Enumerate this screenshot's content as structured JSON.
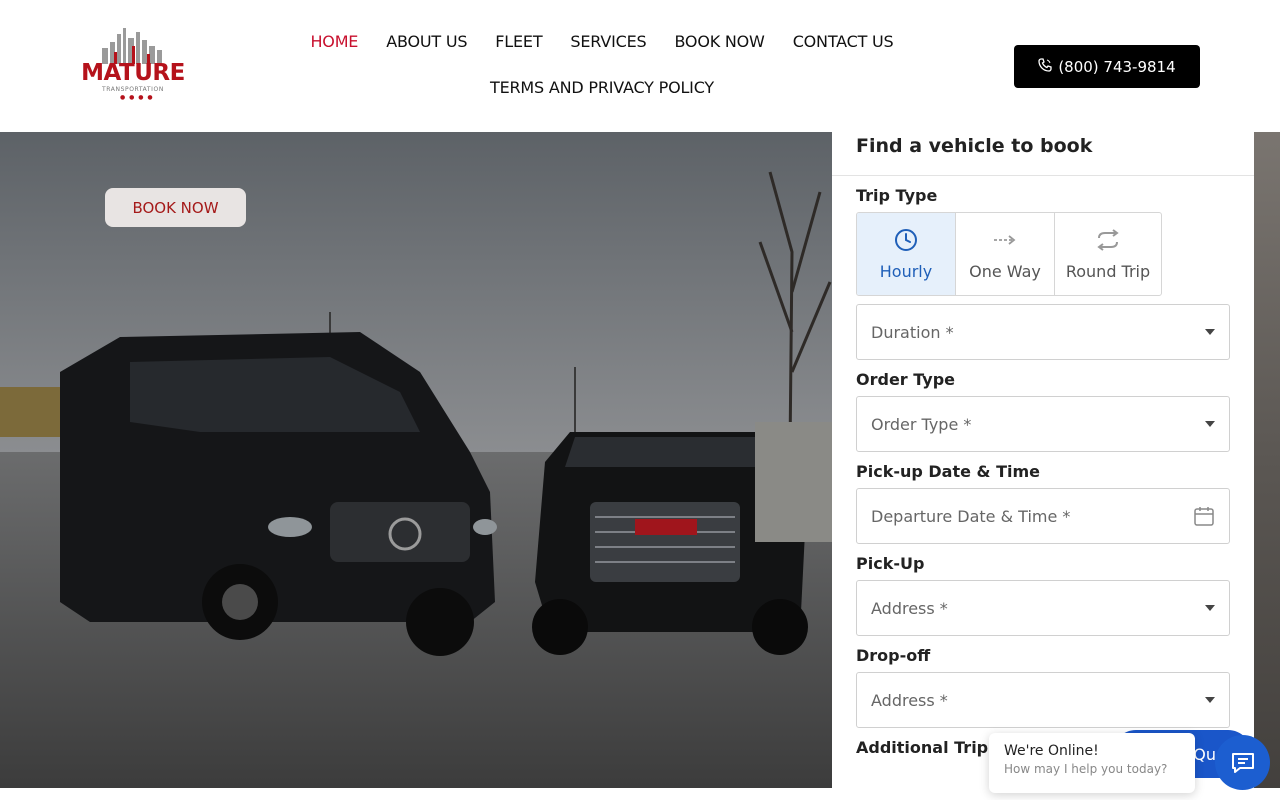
{
  "brand": {
    "name": "MATURE",
    "tagline": "TRANSPORTATION",
    "accent_color": "#c8102e"
  },
  "nav": {
    "items": [
      {
        "label": "HOME",
        "active": true
      },
      {
        "label": "ABOUT US",
        "active": false
      },
      {
        "label": "FLEET",
        "active": false
      },
      {
        "label": "SERVICES",
        "active": false
      },
      {
        "label": "BOOK NOW",
        "active": false
      },
      {
        "label": "CONTACT US",
        "active": false
      },
      {
        "label": "TERMS AND PRIVACY POLICY",
        "active": false
      }
    ]
  },
  "header": {
    "phone": "(800) 743-9814",
    "phone_icon": "phone-icon"
  },
  "hero": {
    "book_now": "BOOK NOW",
    "image_subject": "black van and black SUV"
  },
  "booking": {
    "title": "Find a vehicle to book",
    "trip_type_label": "Trip Type",
    "trip_types": [
      {
        "label": "Hourly",
        "icon": "clock-icon",
        "selected": true
      },
      {
        "label": "One Way",
        "icon": "one-way-arrow-icon",
        "selected": false
      },
      {
        "label": "Round Trip",
        "icon": "round-trip-arrows-icon",
        "selected": false
      }
    ],
    "duration_placeholder": "Duration *",
    "order_type_label": "Order Type",
    "order_type_placeholder": "Order Type *",
    "pickup_datetime_label": "Pick-up Date & Time",
    "pickup_datetime_placeholder": "Departure Date & Time *",
    "pickup_label": "Pick-Up",
    "pickup_placeholder": "Address *",
    "dropoff_label": "Drop-off",
    "dropoff_placeholder": "Address *",
    "additional_label": "Additional Trip D"
  },
  "chat": {
    "title": "We're Online!",
    "subtitle": "How may I help you today?",
    "quote_button": "Qu",
    "launcher_icon": "chat-icon"
  }
}
